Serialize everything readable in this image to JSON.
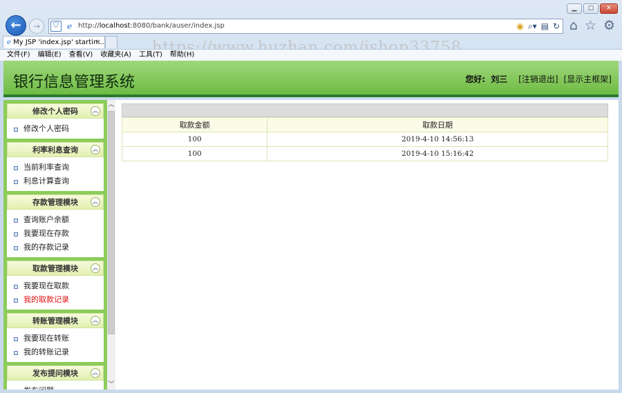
{
  "browser": {
    "url_prefix": "http://",
    "url_host": "localhost",
    "url_rest": ":8080/bank/auser/index.jsp",
    "tab_title": "My JSP 'index.jsp' startin...",
    "watermark": "https://www.huzhan.com/ishop33758",
    "menu": [
      "文件(F)",
      "编辑(E)",
      "查看(V)",
      "收藏夹(A)",
      "工具(T)",
      "帮助(H)"
    ]
  },
  "header": {
    "title": "银行信息管理系统",
    "greeting": "您好:",
    "username": "刘三",
    "logout": "[注销退出]",
    "show_main_frame": "[显示主框架]"
  },
  "sidebar": {
    "groups": [
      {
        "title": "修改个人密码",
        "items": [
          "修改个人密码"
        ]
      },
      {
        "title": "利率利息查询",
        "items": [
          "当前利率查询",
          "利息计算查询"
        ]
      },
      {
        "title": "存款管理模块",
        "items": [
          "查询账户余额",
          "我要现在存款",
          "我的存款记录"
        ]
      },
      {
        "title": "取款管理模块",
        "items": [
          "我要现在取款",
          "我的取款记录"
        ]
      },
      {
        "title": "转账管理模块",
        "items": [
          "我要现在转账",
          "我的转账记录"
        ]
      },
      {
        "title": "发布提问模块",
        "items": [
          "发布问题"
        ]
      }
    ],
    "active_item": "我的取款记录"
  },
  "table": {
    "headers": [
      "取款金额",
      "取款日期"
    ],
    "rows": [
      [
        "100",
        "2019-4-10 14:56:13"
      ],
      [
        "100",
        "2019-4-10 15:16:42"
      ]
    ]
  },
  "colors": {
    "header_green": "#7cc450",
    "active_link": "#e01010"
  }
}
